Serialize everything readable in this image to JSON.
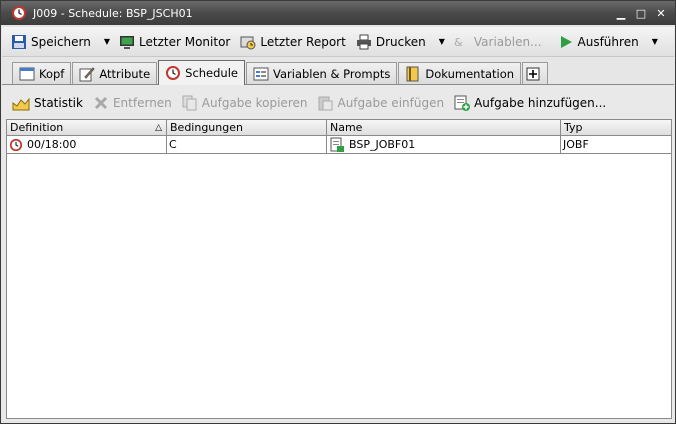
{
  "window": {
    "title": "J009 - Schedule: BSP_JSCH01"
  },
  "toolbar": {
    "save": "Speichern",
    "monitor": "Letzter Monitor",
    "report": "Letzter Report",
    "print": "Drucken",
    "variables": "Variablen...",
    "execute": "Ausführen"
  },
  "tabs": [
    {
      "label": "Kopf"
    },
    {
      "label": "Attribute"
    },
    {
      "label": "Schedule"
    },
    {
      "label": "Variablen & Prompts"
    },
    {
      "label": "Dokumentation"
    }
  ],
  "subtoolbar": {
    "statistics": "Statistik",
    "remove": "Entfernen",
    "copy_task": "Aufgabe kopieren",
    "paste_task": "Aufgabe einfügen",
    "add_task": "Aufgabe hinzufügen..."
  },
  "table": {
    "headers": [
      "Definition",
      "Bedingungen",
      "Name",
      "Typ"
    ],
    "rows": [
      {
        "definition": "00/18:00",
        "conditions": "C",
        "name": "BSP_JOBF01",
        "type": "JOBF"
      }
    ]
  }
}
